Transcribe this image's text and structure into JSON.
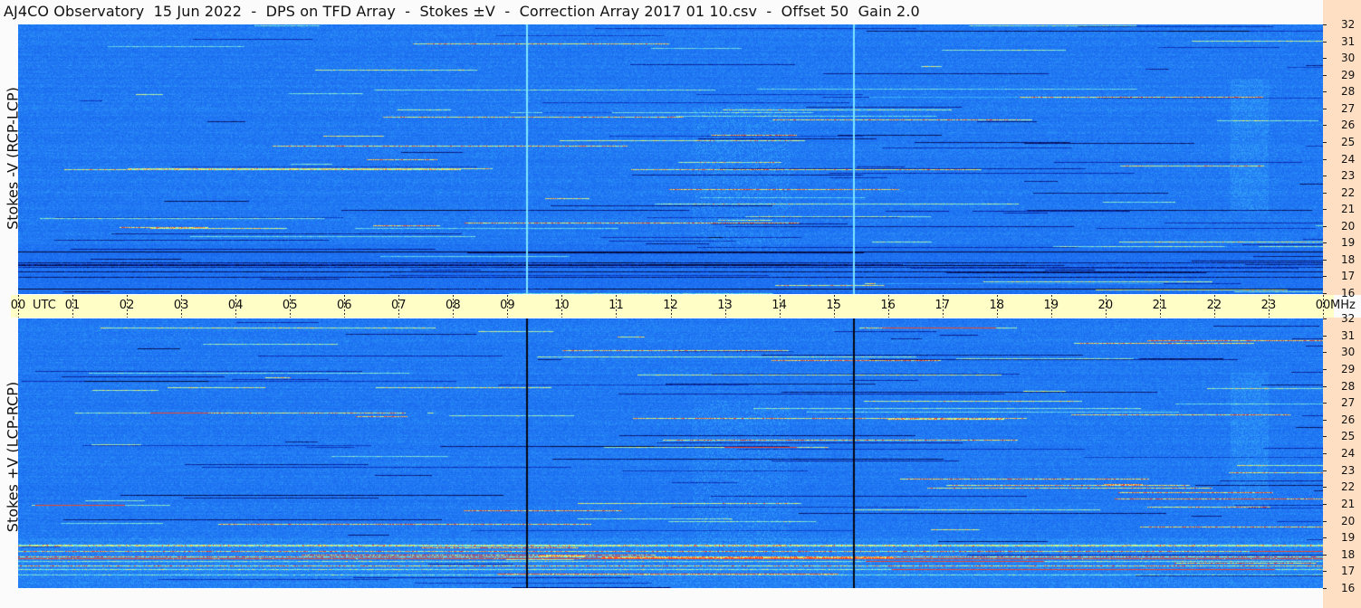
{
  "title": "AJ4CO Observatory  15 Jun 2022  -  DPS on TFD Array  -  Stokes ±V  -  Correction Array 2017 01 10.csv  -  Offset 50  Gain 2.0",
  "time_axis": {
    "labels": [
      "00",
      "01",
      "02",
      "03",
      "04",
      "05",
      "06",
      "07",
      "08",
      "09",
      "10",
      "11",
      "12",
      "13",
      "14",
      "15",
      "16",
      "17",
      "18",
      "19",
      "20",
      "21",
      "22",
      "23",
      "00"
    ],
    "utc_label": "UTC",
    "freq_unit": "MHz"
  },
  "colors": {
    "background": "#1e6ff0",
    "timebar": "#fffec6",
    "freq_panel": "#fedfc3"
  },
  "chart_data": {
    "type": "heatmap",
    "title": "AJ4CO Observatory  15 Jun 2022  -  DPS on TFD Array  -  Stokes ±V  -  Correction Array 2017 01 10.csv  -  Offset 50  Gain 2.0",
    "x_axis": {
      "label": "UTC",
      "range": [
        "00",
        "00"
      ],
      "ticks": [
        "00",
        "01",
        "02",
        "03",
        "04",
        "05",
        "06",
        "07",
        "08",
        "09",
        "10",
        "11",
        "12",
        "13",
        "14",
        "15",
        "16",
        "17",
        "18",
        "19",
        "20",
        "21",
        "22",
        "23",
        "00"
      ]
    },
    "y_axis": {
      "label": "MHz",
      "range": [
        16,
        32
      ],
      "ticks": [
        "32",
        "31",
        "30",
        "29",
        "28",
        "27",
        "26",
        "25",
        "24",
        "23",
        "22",
        "21",
        "20",
        "19",
        "18",
        "17",
        "16"
      ]
    },
    "panels": [
      {
        "name": "Stokes -V (RCP-LCP)",
        "position": "top",
        "marker_lines_utc": [
          9.35,
          15.35
        ],
        "marker_style": "light"
      },
      {
        "name": "Stokes +V (LCP-RCP)",
        "position": "bottom",
        "marker_lines_utc": [
          9.35,
          15.35
        ],
        "marker_style": "dark"
      }
    ],
    "colormap": "blue-cyan-yellow"
  }
}
